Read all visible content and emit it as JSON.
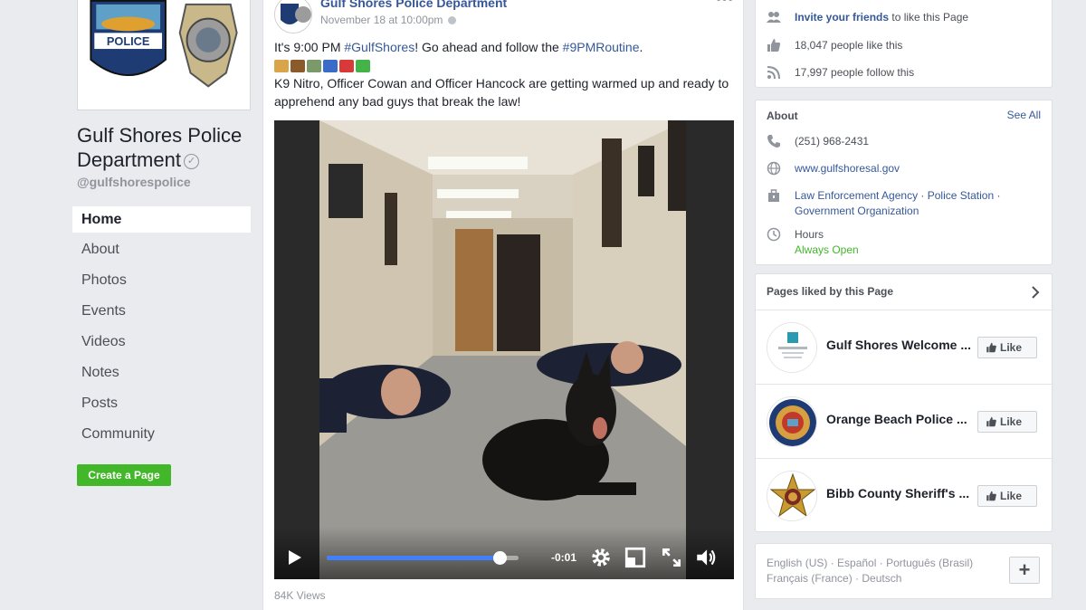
{
  "page": {
    "name": "Gulf Shores Police Department",
    "handle": "@gulfshorespolice",
    "logo_text": "POLICE"
  },
  "nav": {
    "items": [
      {
        "label": "Home",
        "active": true
      },
      {
        "label": "About"
      },
      {
        "label": "Photos"
      },
      {
        "label": "Events"
      },
      {
        "label": "Videos"
      },
      {
        "label": "Notes"
      },
      {
        "label": "Posts"
      },
      {
        "label": "Community"
      }
    ],
    "create_page_label": "Create a Page"
  },
  "post": {
    "author": "Gulf Shores Police Department",
    "timestamp": "November 18 at 10:00pm",
    "line1_pre": "It's 9:00 PM ",
    "hashtag1": "#GulfShores",
    "line1_mid": "! Go ahead and follow the ",
    "hashtag2": "#9PMRoutine",
    "line1_post": ".",
    "body": "K9 Nitro, Officer Cowan and Officer Hancock are getting warmed up and ready to apprehend any bad guys that break the law!",
    "video": {
      "time_remaining": "-0:01",
      "progress": 0.9
    },
    "views": "84K Views"
  },
  "community_card": {
    "invite_link": "Invite your friends",
    "invite_rest": " to like this Page",
    "likes": "18,047 people like this",
    "follows": "17,997 people follow this"
  },
  "about_card": {
    "title": "About",
    "see_all": "See All",
    "phone": "(251) 968-2431",
    "website": "www.gulfshoresal.gov",
    "cat1": "Law Enforcement Agency",
    "cat2": "Police Station",
    "cat3": "Government Organization",
    "sep": " · ",
    "hours_label": "Hours",
    "hours_value": "Always Open"
  },
  "liked_pages": {
    "title": "Pages liked by this Page",
    "like_label": "Like",
    "items": [
      {
        "name": "Gulf Shores Welcome ..."
      },
      {
        "name": "Orange Beach Police ..."
      },
      {
        "name": "Bibb County Sheriff's ..."
      }
    ]
  },
  "languages": {
    "items": [
      "English (US)",
      "Español",
      "Português (Brasil)",
      "Français (France)",
      "Deutsch"
    ],
    "plus_label": "+"
  },
  "colors": {
    "link": "#365899",
    "green": "#42b72a",
    "background": "#e9ebee",
    "progress": "#4080ff"
  },
  "icons": {
    "invite": "people-icon",
    "likes": "thumb-up-icon",
    "follows": "rss-icon",
    "phone": "phone-icon",
    "website": "globe-icon",
    "category": "briefcase-icon",
    "hours": "clock-icon"
  }
}
